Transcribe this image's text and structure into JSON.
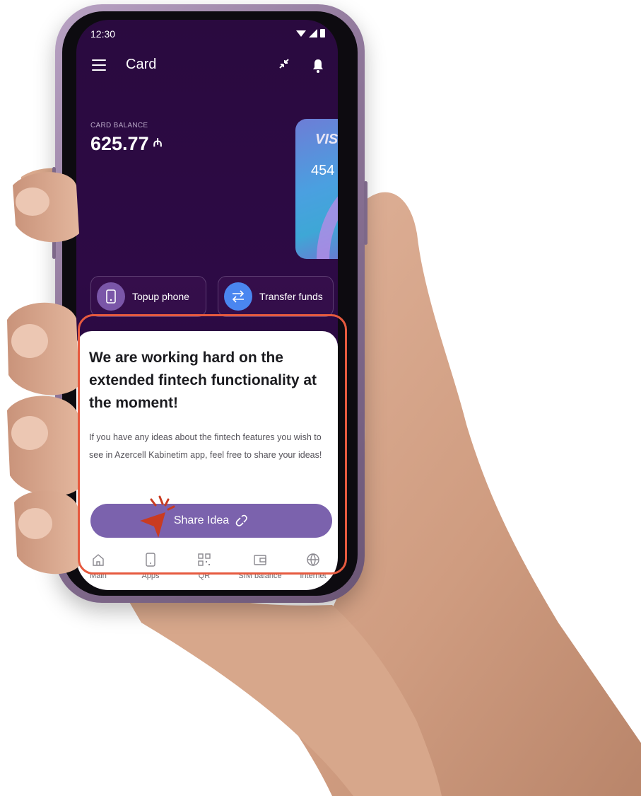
{
  "status": {
    "time": "12:30"
  },
  "appbar": {
    "title": "Card"
  },
  "balance": {
    "label": "CARD BALANCE",
    "value": "625.77",
    "currency": "₼"
  },
  "card": {
    "brand": "VISA",
    "number_visible": "454"
  },
  "actions": [
    {
      "label": "Topup phone",
      "icon": "phone-icon"
    },
    {
      "label": "Transfer funds",
      "icon": "transfer-icon"
    }
  ],
  "sheet": {
    "title": "We are working hard on the extended fintech functionality at the moment!",
    "body": "If you have any ideas about the fintech features you wish to see in Azercell Kabinetim app, feel free to share your ideas!",
    "button_label": "Share Idea"
  },
  "nav": {
    "items": [
      {
        "label": "Main",
        "icon": "home-icon"
      },
      {
        "label": "Apps",
        "icon": "apps-icon"
      },
      {
        "label": "QR",
        "icon": "qr-icon"
      },
      {
        "label": "SIM balance",
        "icon": "wallet-icon"
      },
      {
        "label": "Internet",
        "icon": "globe-icon"
      }
    ]
  },
  "colors": {
    "screen_bg": "#2a0a3f",
    "accent": "#7b62ad",
    "highlight": "#e65a3f",
    "transfer_blue": "#4a86f0"
  }
}
